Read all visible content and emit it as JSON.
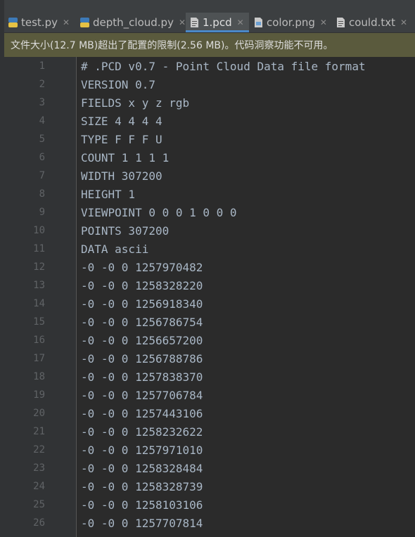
{
  "tabs": [
    {
      "label": "test.py",
      "icon": "python-file-icon",
      "active": false
    },
    {
      "label": "depth_cloud.py",
      "icon": "python-file-icon",
      "active": false
    },
    {
      "label": "1.pcd",
      "icon": "text-file-icon",
      "active": true
    },
    {
      "label": "color.png",
      "icon": "image-file-icon",
      "active": false
    },
    {
      "label": "could.txt",
      "icon": "text-file-icon",
      "active": false
    }
  ],
  "banner": {
    "message": "文件大小(12.7 MB)超出了配置的限制(2.56 MB)。代码洞察功能不可用。"
  },
  "lines": [
    {
      "n": "1",
      "text": "# .PCD v0.7 - Point Cloud Data file format"
    },
    {
      "n": "2",
      "text": "VERSION 0.7"
    },
    {
      "n": "3",
      "text": "FIELDS x y z rgb"
    },
    {
      "n": "4",
      "text": "SIZE 4 4 4 4"
    },
    {
      "n": "5",
      "text": "TYPE F F F U"
    },
    {
      "n": "6",
      "text": "COUNT 1 1 1 1"
    },
    {
      "n": "7",
      "text": "WIDTH 307200"
    },
    {
      "n": "8",
      "text": "HEIGHT 1"
    },
    {
      "n": "9",
      "text": "VIEWPOINT 0 0 0 1 0 0 0"
    },
    {
      "n": "10",
      "text": "POINTS 307200"
    },
    {
      "n": "11",
      "text": "DATA ascii"
    },
    {
      "n": "12",
      "text": "-0 -0 0 1257970482"
    },
    {
      "n": "13",
      "text": "-0 -0 0 1258328220"
    },
    {
      "n": "14",
      "text": "-0 -0 0 1256918340"
    },
    {
      "n": "15",
      "text": "-0 -0 0 1256786754"
    },
    {
      "n": "16",
      "text": "-0 -0 0 1256657200"
    },
    {
      "n": "17",
      "text": "-0 -0 0 1256788786"
    },
    {
      "n": "18",
      "text": "-0 -0 0 1257838370"
    },
    {
      "n": "19",
      "text": "-0 -0 0 1257706784"
    },
    {
      "n": "20",
      "text": "-0 -0 0 1257443106"
    },
    {
      "n": "21",
      "text": "-0 -0 0 1258232622"
    },
    {
      "n": "22",
      "text": "-0 -0 0 1257971010"
    },
    {
      "n": "23",
      "text": "-0 -0 0 1258328484"
    },
    {
      "n": "24",
      "text": "-0 -0 0 1258328739"
    },
    {
      "n": "25",
      "text": "-0 -0 0 1258103106"
    },
    {
      "n": "26",
      "text": "-0 -0 0 1257707814"
    }
  ],
  "colors": {
    "accent": "#4a88c7",
    "banner_bg": "#5a5a3d",
    "editor_bg": "#2b2b2b",
    "code_text": "#a9b7c6",
    "line_number": "#606366"
  }
}
